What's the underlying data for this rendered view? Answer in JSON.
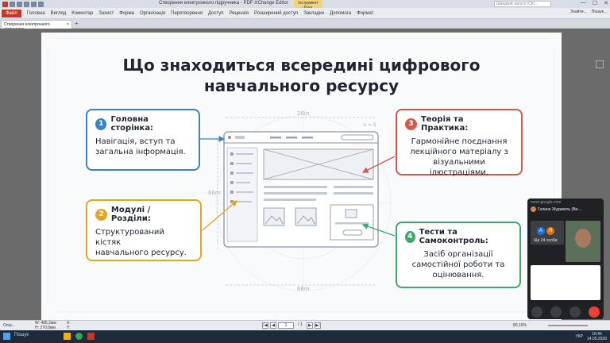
{
  "window": {
    "title": "Створення електронного підручника - PDF-XChange Editor",
    "context_tab": [
      "Інструмент",
      "Рука"
    ],
    "search_placeholder": "Швидкий запуск (Ctrl...",
    "controls": [
      "—",
      "☐",
      "✕"
    ]
  },
  "menu": {
    "file": "Файл",
    "items": [
      "Головна",
      "Вигляд",
      "Коментар",
      "Захист",
      "Форма",
      "Організація",
      "Перетворення",
      "Доступ",
      "Рецензія",
      "Розширений доступ",
      "Закладки",
      "Допомога",
      "Формат"
    ],
    "right": [
      "Знайти...",
      "Пошук..."
    ]
  },
  "doc_tab": {
    "label": "Створення електронного підручника",
    "close": "×",
    "add": "+"
  },
  "slide": {
    "title_line1": "Що знаходиться всередині цифрового",
    "title_line2": "навчального ресурсу",
    "cards": [
      {
        "num": "1",
        "title": "Головна сторінка:",
        "body": [
          "Навігація, вступ та",
          "загальна інформація."
        ],
        "color": "#3b82c4"
      },
      {
        "num": "2",
        "title": "Модулі / Розділи:",
        "body": [
          "Структурований кістяк",
          "навчального ресурсу."
        ],
        "color": "#e0a625"
      },
      {
        "num": "3",
        "title": "Теорія та Практика:",
        "body": [
          "Гармонійне поєднання",
          "лекційного матеріалу з",
          "візуальними ілюстраціями."
        ],
        "color": "#d25a48"
      },
      {
        "num": "4",
        "title": "Тести та Самоконтроль:",
        "body": [
          "Засіб організації",
          "самостійної роботи та",
          "оцінювання."
        ],
        "color": "#3fa86b"
      }
    ],
    "dims": {
      "top": "26in",
      "left": "66m",
      "bottom": "66m",
      "corner": "z = 5"
    }
  },
  "status": {
    "left_label": "Опці...",
    "coords": [
      "W: 485,2мм",
      "H: 270,0мм"
    ],
    "xy": [
      "X:",
      "Y:"
    ],
    "page": "1",
    "page_total": "/ 1",
    "zoom": "80,10%"
  },
  "meet": {
    "url": "meet.google.com",
    "user": "Галина Журавель (Ви...",
    "avatar_letters": [
      "А",
      "Я"
    ],
    "participants": "Ще 24 особи"
  },
  "taskbar": {
    "search": "Пошук",
    "lang": "УКР",
    "time": "16:45",
    "date": "14.05.2026"
  }
}
